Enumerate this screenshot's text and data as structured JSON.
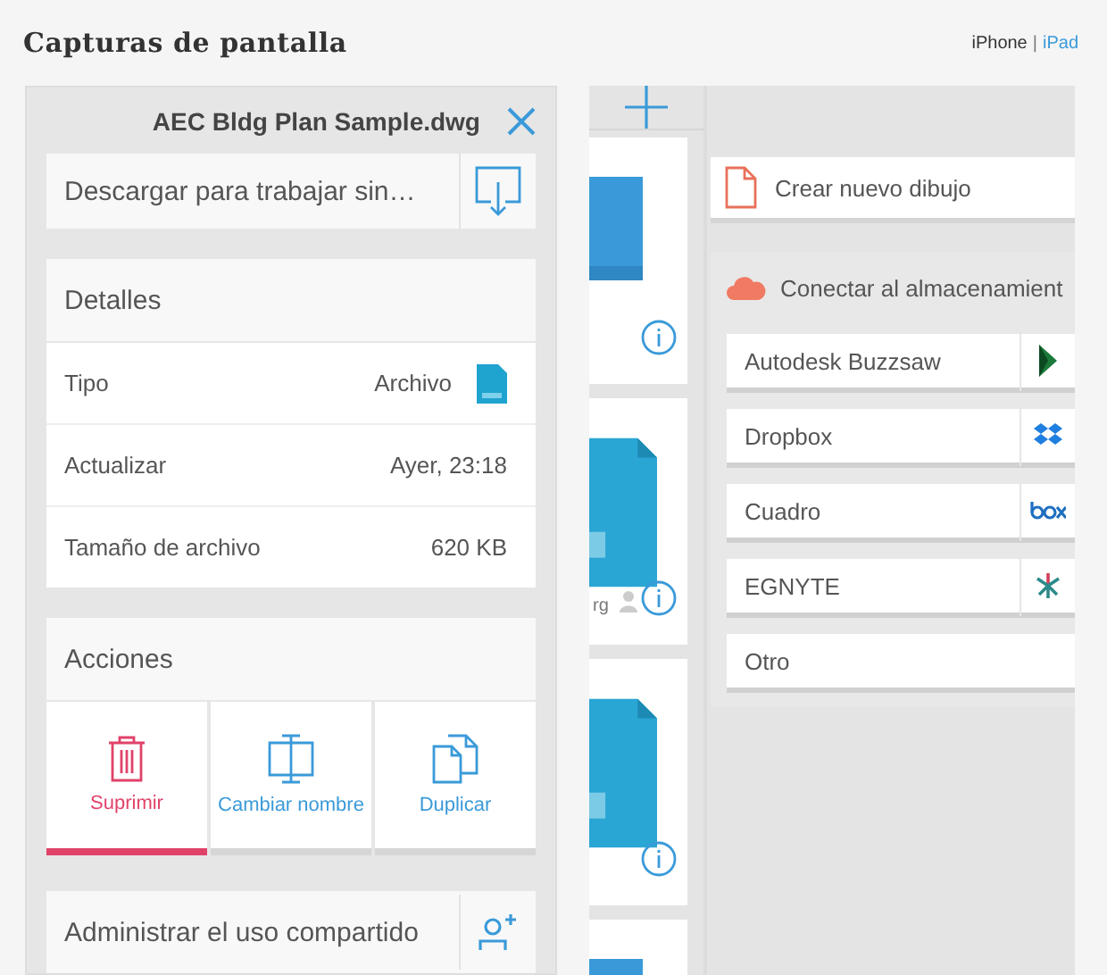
{
  "header": {
    "title": "Capturas de pantalla",
    "device_links": [
      {
        "label": "iPhone",
        "selected": false
      },
      {
        "label": "iPad",
        "selected": true
      }
    ],
    "link_separator": "|"
  },
  "detail_panel": {
    "title": "AEC Bldg Plan Sample.dwg",
    "download": {
      "label": "Descargar para trabajar sin…"
    },
    "details": {
      "title": "Detalles",
      "rows": [
        {
          "label": "Tipo",
          "value": "Archivo",
          "kind": "file"
        },
        {
          "label": "Actualizar",
          "value": "Ayer, 23:18",
          "kind": "text"
        },
        {
          "label": "Tamaño de archivo",
          "value": "620 KB",
          "kind": "text"
        }
      ]
    },
    "actions": {
      "title": "Acciones",
      "buttons": [
        {
          "label": "Suprimir",
          "kind": "delete",
          "selected": true
        },
        {
          "label": "Cambiar nombre",
          "kind": "rename",
          "selected": false
        },
        {
          "label": "Duplicar",
          "kind": "duplicate",
          "selected": false
        }
      ]
    },
    "share": {
      "label": "Administrar el uso compartido"
    }
  },
  "thumbnails": [
    {
      "kind": "flat",
      "info": true
    },
    {
      "kind": "box",
      "caption": "rg",
      "info": true
    },
    {
      "kind": "box",
      "info": true
    },
    {
      "kind": "flat"
    }
  ],
  "new_drawing": {
    "label": "Crear nuevo dibujo"
  },
  "storage": {
    "title": "Conectar al almacenamient",
    "services": [
      {
        "name": "Autodesk Buzzsaw",
        "kind": "buzzsaw"
      },
      {
        "name": "Dropbox",
        "kind": "dropbox"
      },
      {
        "name": "Cuadro",
        "kind": "box"
      },
      {
        "name": "EGNYTE",
        "kind": "egnyte"
      },
      {
        "name": "Otro",
        "kind": "other"
      }
    ]
  }
}
